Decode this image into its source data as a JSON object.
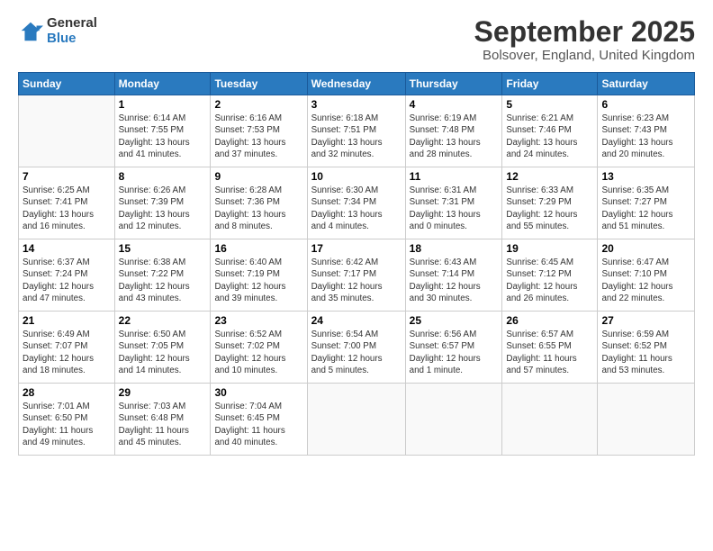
{
  "logo": {
    "general": "General",
    "blue": "Blue"
  },
  "title": "September 2025",
  "subtitle": "Bolsover, England, United Kingdom",
  "days_header": [
    "Sunday",
    "Monday",
    "Tuesday",
    "Wednesday",
    "Thursday",
    "Friday",
    "Saturday"
  ],
  "weeks": [
    [
      {
        "num": "",
        "info": ""
      },
      {
        "num": "1",
        "info": "Sunrise: 6:14 AM\nSunset: 7:55 PM\nDaylight: 13 hours\nand 41 minutes."
      },
      {
        "num": "2",
        "info": "Sunrise: 6:16 AM\nSunset: 7:53 PM\nDaylight: 13 hours\nand 37 minutes."
      },
      {
        "num": "3",
        "info": "Sunrise: 6:18 AM\nSunset: 7:51 PM\nDaylight: 13 hours\nand 32 minutes."
      },
      {
        "num": "4",
        "info": "Sunrise: 6:19 AM\nSunset: 7:48 PM\nDaylight: 13 hours\nand 28 minutes."
      },
      {
        "num": "5",
        "info": "Sunrise: 6:21 AM\nSunset: 7:46 PM\nDaylight: 13 hours\nand 24 minutes."
      },
      {
        "num": "6",
        "info": "Sunrise: 6:23 AM\nSunset: 7:43 PM\nDaylight: 13 hours\nand 20 minutes."
      }
    ],
    [
      {
        "num": "7",
        "info": "Sunrise: 6:25 AM\nSunset: 7:41 PM\nDaylight: 13 hours\nand 16 minutes."
      },
      {
        "num": "8",
        "info": "Sunrise: 6:26 AM\nSunset: 7:39 PM\nDaylight: 13 hours\nand 12 minutes."
      },
      {
        "num": "9",
        "info": "Sunrise: 6:28 AM\nSunset: 7:36 PM\nDaylight: 13 hours\nand 8 minutes."
      },
      {
        "num": "10",
        "info": "Sunrise: 6:30 AM\nSunset: 7:34 PM\nDaylight: 13 hours\nand 4 minutes."
      },
      {
        "num": "11",
        "info": "Sunrise: 6:31 AM\nSunset: 7:31 PM\nDaylight: 13 hours\nand 0 minutes."
      },
      {
        "num": "12",
        "info": "Sunrise: 6:33 AM\nSunset: 7:29 PM\nDaylight: 12 hours\nand 55 minutes."
      },
      {
        "num": "13",
        "info": "Sunrise: 6:35 AM\nSunset: 7:27 PM\nDaylight: 12 hours\nand 51 minutes."
      }
    ],
    [
      {
        "num": "14",
        "info": "Sunrise: 6:37 AM\nSunset: 7:24 PM\nDaylight: 12 hours\nand 47 minutes."
      },
      {
        "num": "15",
        "info": "Sunrise: 6:38 AM\nSunset: 7:22 PM\nDaylight: 12 hours\nand 43 minutes."
      },
      {
        "num": "16",
        "info": "Sunrise: 6:40 AM\nSunset: 7:19 PM\nDaylight: 12 hours\nand 39 minutes."
      },
      {
        "num": "17",
        "info": "Sunrise: 6:42 AM\nSunset: 7:17 PM\nDaylight: 12 hours\nand 35 minutes."
      },
      {
        "num": "18",
        "info": "Sunrise: 6:43 AM\nSunset: 7:14 PM\nDaylight: 12 hours\nand 30 minutes."
      },
      {
        "num": "19",
        "info": "Sunrise: 6:45 AM\nSunset: 7:12 PM\nDaylight: 12 hours\nand 26 minutes."
      },
      {
        "num": "20",
        "info": "Sunrise: 6:47 AM\nSunset: 7:10 PM\nDaylight: 12 hours\nand 22 minutes."
      }
    ],
    [
      {
        "num": "21",
        "info": "Sunrise: 6:49 AM\nSunset: 7:07 PM\nDaylight: 12 hours\nand 18 minutes."
      },
      {
        "num": "22",
        "info": "Sunrise: 6:50 AM\nSunset: 7:05 PM\nDaylight: 12 hours\nand 14 minutes."
      },
      {
        "num": "23",
        "info": "Sunrise: 6:52 AM\nSunset: 7:02 PM\nDaylight: 12 hours\nand 10 minutes."
      },
      {
        "num": "24",
        "info": "Sunrise: 6:54 AM\nSunset: 7:00 PM\nDaylight: 12 hours\nand 5 minutes."
      },
      {
        "num": "25",
        "info": "Sunrise: 6:56 AM\nSunset: 6:57 PM\nDaylight: 12 hours\nand 1 minute."
      },
      {
        "num": "26",
        "info": "Sunrise: 6:57 AM\nSunset: 6:55 PM\nDaylight: 11 hours\nand 57 minutes."
      },
      {
        "num": "27",
        "info": "Sunrise: 6:59 AM\nSunset: 6:52 PM\nDaylight: 11 hours\nand 53 minutes."
      }
    ],
    [
      {
        "num": "28",
        "info": "Sunrise: 7:01 AM\nSunset: 6:50 PM\nDaylight: 11 hours\nand 49 minutes."
      },
      {
        "num": "29",
        "info": "Sunrise: 7:03 AM\nSunset: 6:48 PM\nDaylight: 11 hours\nand 45 minutes."
      },
      {
        "num": "30",
        "info": "Sunrise: 7:04 AM\nSunset: 6:45 PM\nDaylight: 11 hours\nand 40 minutes."
      },
      {
        "num": "",
        "info": ""
      },
      {
        "num": "",
        "info": ""
      },
      {
        "num": "",
        "info": ""
      },
      {
        "num": "",
        "info": ""
      }
    ]
  ]
}
